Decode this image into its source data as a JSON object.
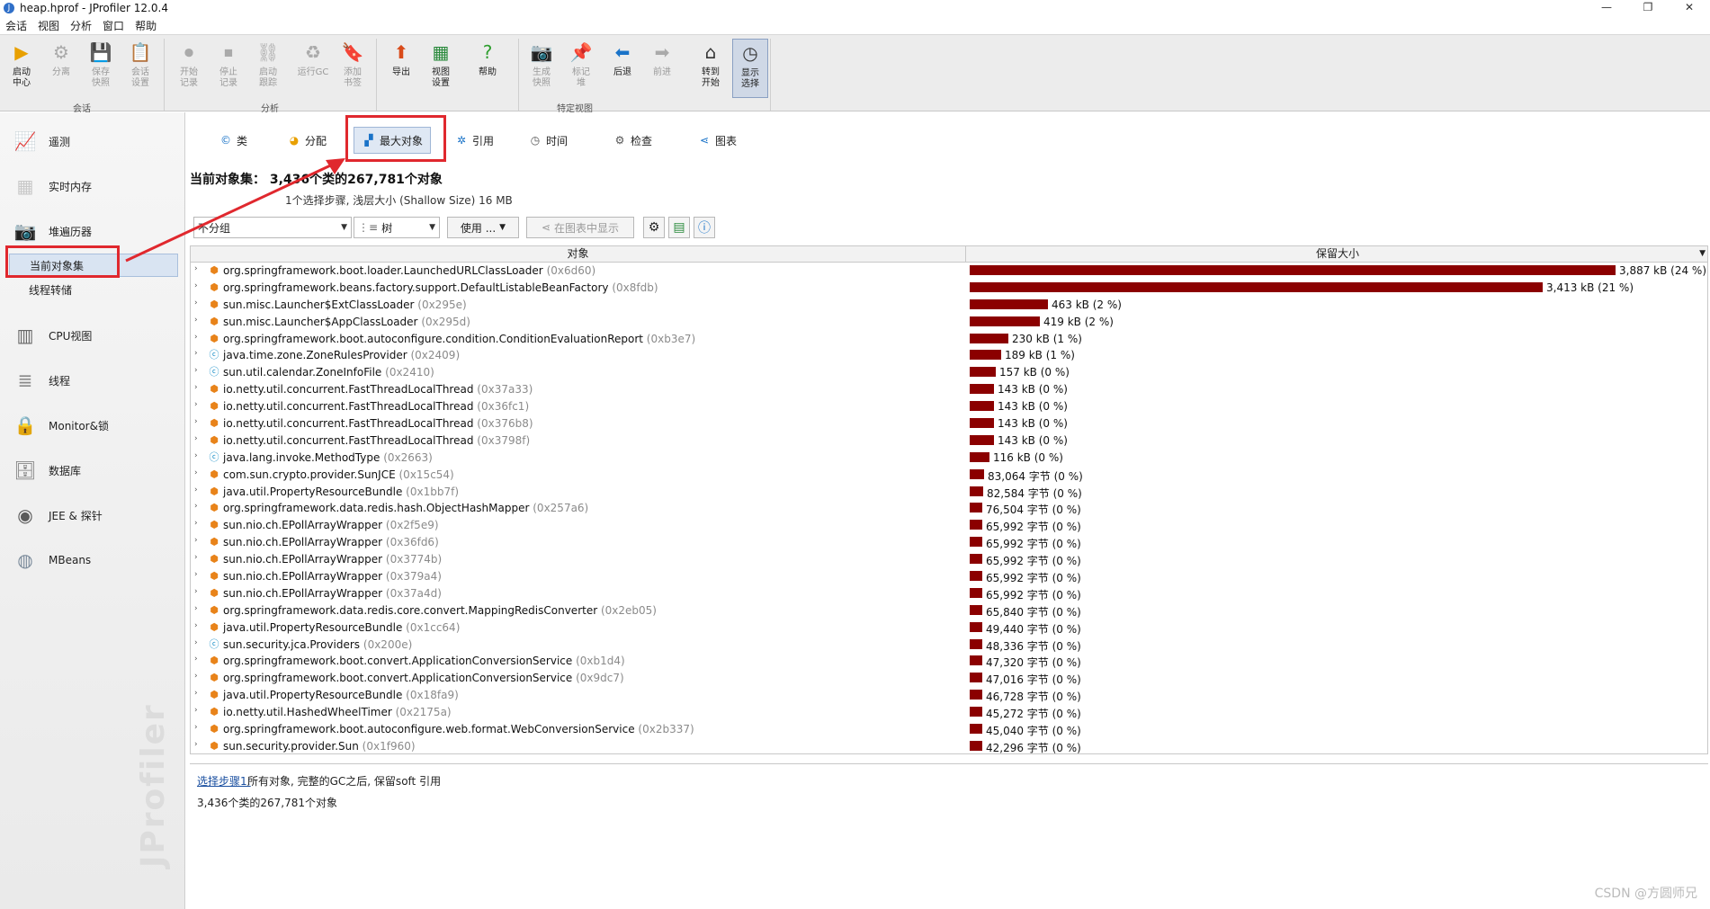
{
  "window": {
    "title": "heap.hprof - JProfiler 12.0.4",
    "minimize": "—",
    "restore": "❐",
    "close": "✕"
  },
  "menu": [
    "会话",
    "视图",
    "分析",
    "窗口",
    "帮助"
  ],
  "ribbon": {
    "tools": [
      {
        "label": "启动\n中心",
        "icon": "start-center-icon",
        "glyph": "▶",
        "color": "#e8a000",
        "enabled": true
      },
      {
        "label": "分离",
        "icon": "detach-icon",
        "glyph": "⚙",
        "enabled": false
      },
      {
        "label": "保存\n快照",
        "icon": "save-snapshot-icon",
        "glyph": "💾",
        "enabled": false
      },
      {
        "label": "会话\n设置",
        "icon": "session-settings-icon",
        "glyph": "📋",
        "enabled": false
      },
      {
        "label": "开始\n记录",
        "icon": "start-recording-icon",
        "glyph": "⏺",
        "enabled": false
      },
      {
        "label": "停止\n记录",
        "icon": "stop-recording-icon",
        "glyph": "⏹",
        "enabled": false
      },
      {
        "label": "启动\n跟踪",
        "icon": "start-tracking-icon",
        "glyph": "⛓",
        "enabled": false
      },
      {
        "label": "运行GC",
        "icon": "run-gc-icon",
        "glyph": "♻",
        "enabled": false
      },
      {
        "label": "添加\n书签",
        "icon": "add-bookmark-icon",
        "glyph": "🔖",
        "enabled": false
      },
      {
        "label": "导出",
        "icon": "export-icon",
        "glyph": "⬆",
        "color": "#d94b1a",
        "enabled": true
      },
      {
        "label": "视图\n设置",
        "icon": "view-settings-icon",
        "glyph": "▦",
        "color": "#2a8a3c",
        "enabled": true
      },
      {
        "label": "帮助",
        "icon": "help-icon",
        "glyph": "?",
        "color": "#2e9e2e",
        "enabled": true
      },
      {
        "label": "生成\n快照",
        "icon": "generate-snapshot-icon",
        "glyph": "📷",
        "enabled": false
      },
      {
        "label": "标记\n堆",
        "icon": "mark-heap-icon",
        "glyph": "📌",
        "enabled": false
      },
      {
        "label": "后退",
        "icon": "back-icon",
        "glyph": "⬅",
        "color": "#1a73c8",
        "enabled": true
      },
      {
        "label": "前进",
        "icon": "forward-icon",
        "glyph": "➡",
        "enabled": false
      },
      {
        "label": "转到\n开始",
        "icon": "go-to-start-icon",
        "glyph": "⌂",
        "color": "#333",
        "enabled": true
      },
      {
        "label": "显示\n选择",
        "icon": "show-selection-icon",
        "glyph": "◷",
        "color": "#333",
        "enabled": true,
        "active": true
      }
    ],
    "groups": [
      "会话",
      "分析",
      "特定视图"
    ]
  },
  "sidebar": {
    "items": [
      {
        "label": "遥测",
        "icon": "telemetry-icon",
        "glyph": "📈"
      },
      {
        "label": "实时内存",
        "icon": "live-memory-icon",
        "glyph": "▦"
      },
      {
        "label": "堆遍历器",
        "icon": "heap-walker-icon",
        "glyph": "📷"
      },
      {
        "label": "CPU视图",
        "icon": "cpu-views-icon",
        "glyph": "▥"
      },
      {
        "label": "线程",
        "icon": "threads-icon",
        "glyph": "≣"
      },
      {
        "label": "Monitor&锁",
        "icon": "monitor-lock-icon",
        "glyph": "🔒"
      },
      {
        "label": "数据库",
        "icon": "database-icon",
        "glyph": "🗄"
      },
      {
        "label": "JEE & 探针",
        "icon": "jee-probes-icon",
        "glyph": "◉"
      },
      {
        "label": "MBeans",
        "icon": "mbeans-icon",
        "glyph": "◍"
      }
    ],
    "subitems": [
      {
        "label": "当前对象集",
        "selected": true
      },
      {
        "label": "线程转储",
        "selected": false
      }
    ],
    "watermark": "JProfiler"
  },
  "tabs": [
    {
      "label": "类",
      "icon": "class-icon",
      "glyph": "©",
      "selected": false
    },
    {
      "label": "分配",
      "icon": "allocation-icon",
      "glyph": "◕",
      "selected": false
    },
    {
      "label": "最大对象",
      "icon": "biggest-objects-icon",
      "glyph": "▞",
      "selected": true
    },
    {
      "label": "引用",
      "icon": "references-icon",
      "glyph": "✲",
      "selected": false
    },
    {
      "label": "时间",
      "icon": "time-icon",
      "glyph": "◷",
      "selected": false
    },
    {
      "label": "检查",
      "icon": "inspection-icon",
      "glyph": "⚙",
      "selected": false
    },
    {
      "label": "图表",
      "icon": "graph-icon",
      "glyph": "⋖",
      "selected": false
    }
  ],
  "objectset": {
    "heading": "当前对象集：   3,436个类的267,781个对象",
    "subheading": "1个选择步骤, 浅层大小 (Shallow Size) 16 MB"
  },
  "controls": {
    "grouping": "不分组",
    "view_mode": "树",
    "use": "使用 ...",
    "show_in_graph": "在图表中显示"
  },
  "table": {
    "columns": [
      "对象",
      "保留大小"
    ],
    "max_percent": 24,
    "rows": [
      {
        "name": "org.springframework.boot.loader.LaunchedURLClassLoader",
        "addr": "(0x6d60)",
        "size": "3,887 kB (24 %)",
        "pct": 24,
        "kind": "obj"
      },
      {
        "name": "org.springframework.beans.factory.support.DefaultListableBeanFactory",
        "addr": "(0x8fdb)",
        "size": "3,413 kB (21 %)",
        "pct": 21.3,
        "kind": "obj"
      },
      {
        "name": "sun.misc.Launcher$ExtClassLoader",
        "addr": "(0x295e)",
        "size": "463 kB (2 %)",
        "pct": 2.9,
        "kind": "obj"
      },
      {
        "name": "sun.misc.Launcher$AppClassLoader",
        "addr": "(0x295d)",
        "size": "419 kB (2 %)",
        "pct": 2.6,
        "kind": "obj"
      },
      {
        "name": "org.springframework.boot.autoconfigure.condition.ConditionEvaluationReport",
        "addr": "(0xb3e7)",
        "size": "230 kB (1 %)",
        "pct": 1.43,
        "kind": "obj"
      },
      {
        "name": "java.time.zone.ZoneRulesProvider",
        "addr": "(0x2409)",
        "size": "189 kB (1 %)",
        "pct": 1.18,
        "kind": "class"
      },
      {
        "name": "sun.util.calendar.ZoneInfoFile",
        "addr": "(0x2410)",
        "size": "157 kB (0 %)",
        "pct": 0.98,
        "kind": "class"
      },
      {
        "name": "io.netty.util.concurrent.FastThreadLocalThread",
        "addr": "(0x37a33)",
        "size": "143 kB (0 %)",
        "pct": 0.89,
        "kind": "obj"
      },
      {
        "name": "io.netty.util.concurrent.FastThreadLocalThread",
        "addr": "(0x36fc1)",
        "size": "143 kB (0 %)",
        "pct": 0.89,
        "kind": "obj"
      },
      {
        "name": "io.netty.util.concurrent.FastThreadLocalThread",
        "addr": "(0x376b8)",
        "size": "143 kB (0 %)",
        "pct": 0.89,
        "kind": "obj"
      },
      {
        "name": "io.netty.util.concurrent.FastThreadLocalThread",
        "addr": "(0x3798f)",
        "size": "143 kB (0 %)",
        "pct": 0.89,
        "kind": "obj"
      },
      {
        "name": "java.lang.invoke.MethodType",
        "addr": "(0x2663)",
        "size": "116 kB (0 %)",
        "pct": 0.72,
        "kind": "class"
      },
      {
        "name": "com.sun.crypto.provider.SunJCE",
        "addr": "(0x15c54)",
        "size": "83,064 字节 (0 %)",
        "pct": 0.52,
        "kind": "obj"
      },
      {
        "name": "java.util.PropertyResourceBundle",
        "addr": "(0x1bb7f)",
        "size": "82,584 字节 (0 %)",
        "pct": 0.51,
        "kind": "obj"
      },
      {
        "name": "org.springframework.data.redis.hash.ObjectHashMapper",
        "addr": "(0x257a6)",
        "size": "76,504 字节 (0 %)",
        "pct": 0.48,
        "kind": "obj"
      },
      {
        "name": "sun.nio.ch.EPollArrayWrapper",
        "addr": "(0x2f5e9)",
        "size": "65,992 字节 (0 %)",
        "pct": 0.41,
        "kind": "obj"
      },
      {
        "name": "sun.nio.ch.EPollArrayWrapper",
        "addr": "(0x36fd6)",
        "size": "65,992 字节 (0 %)",
        "pct": 0.41,
        "kind": "obj"
      },
      {
        "name": "sun.nio.ch.EPollArrayWrapper",
        "addr": "(0x3774b)",
        "size": "65,992 字节 (0 %)",
        "pct": 0.41,
        "kind": "obj"
      },
      {
        "name": "sun.nio.ch.EPollArrayWrapper",
        "addr": "(0x379a4)",
        "size": "65,992 字节 (0 %)",
        "pct": 0.41,
        "kind": "obj"
      },
      {
        "name": "sun.nio.ch.EPollArrayWrapper",
        "addr": "(0x37a4d)",
        "size": "65,992 字节 (0 %)",
        "pct": 0.41,
        "kind": "obj"
      },
      {
        "name": "org.springframework.data.redis.core.convert.MappingRedisConverter",
        "addr": "(0x2eb05)",
        "size": "65,840 字节 (0 %)",
        "pct": 0.41,
        "kind": "obj"
      },
      {
        "name": "java.util.PropertyResourceBundle",
        "addr": "(0x1cc64)",
        "size": "49,440 字节 (0 %)",
        "pct": 0.31,
        "kind": "obj"
      },
      {
        "name": "sun.security.jca.Providers",
        "addr": "(0x200e)",
        "size": "48,336 字节 (0 %)",
        "pct": 0.3,
        "kind": "class"
      },
      {
        "name": "org.springframework.boot.convert.ApplicationConversionService",
        "addr": "(0xb1d4)",
        "size": "47,320 字节 (0 %)",
        "pct": 0.29,
        "kind": "obj"
      },
      {
        "name": "org.springframework.boot.convert.ApplicationConversionService",
        "addr": "(0x9dc7)",
        "size": "47,016 字节 (0 %)",
        "pct": 0.29,
        "kind": "obj"
      },
      {
        "name": "java.util.PropertyResourceBundle",
        "addr": "(0x18fa9)",
        "size": "46,728 字节 (0 %)",
        "pct": 0.29,
        "kind": "obj"
      },
      {
        "name": "io.netty.util.HashedWheelTimer",
        "addr": "(0x2175a)",
        "size": "45,272 字节 (0 %)",
        "pct": 0.28,
        "kind": "obj"
      },
      {
        "name": "org.springframework.boot.autoconfigure.web.format.WebConversionService",
        "addr": "(0x2b337)",
        "size": "45,040 字节 (0 %)",
        "pct": 0.28,
        "kind": "obj"
      },
      {
        "name": "sun.security.provider.Sun",
        "addr": "(0x1f960)",
        "size": "42,296 字节 (0 %)",
        "pct": 0.26,
        "kind": "obj"
      }
    ]
  },
  "steps": {
    "link": "选择步骤1:",
    "description": "所有对象, 完整的GC之后, 保留soft 引用",
    "summary": "3,436个类的267,781个对象"
  },
  "footer_watermark": "CSDN @方圆师兄",
  "colors": {
    "bar": "#8b0000",
    "annotation": "#e0282e",
    "selection": "#d9e4f2"
  }
}
